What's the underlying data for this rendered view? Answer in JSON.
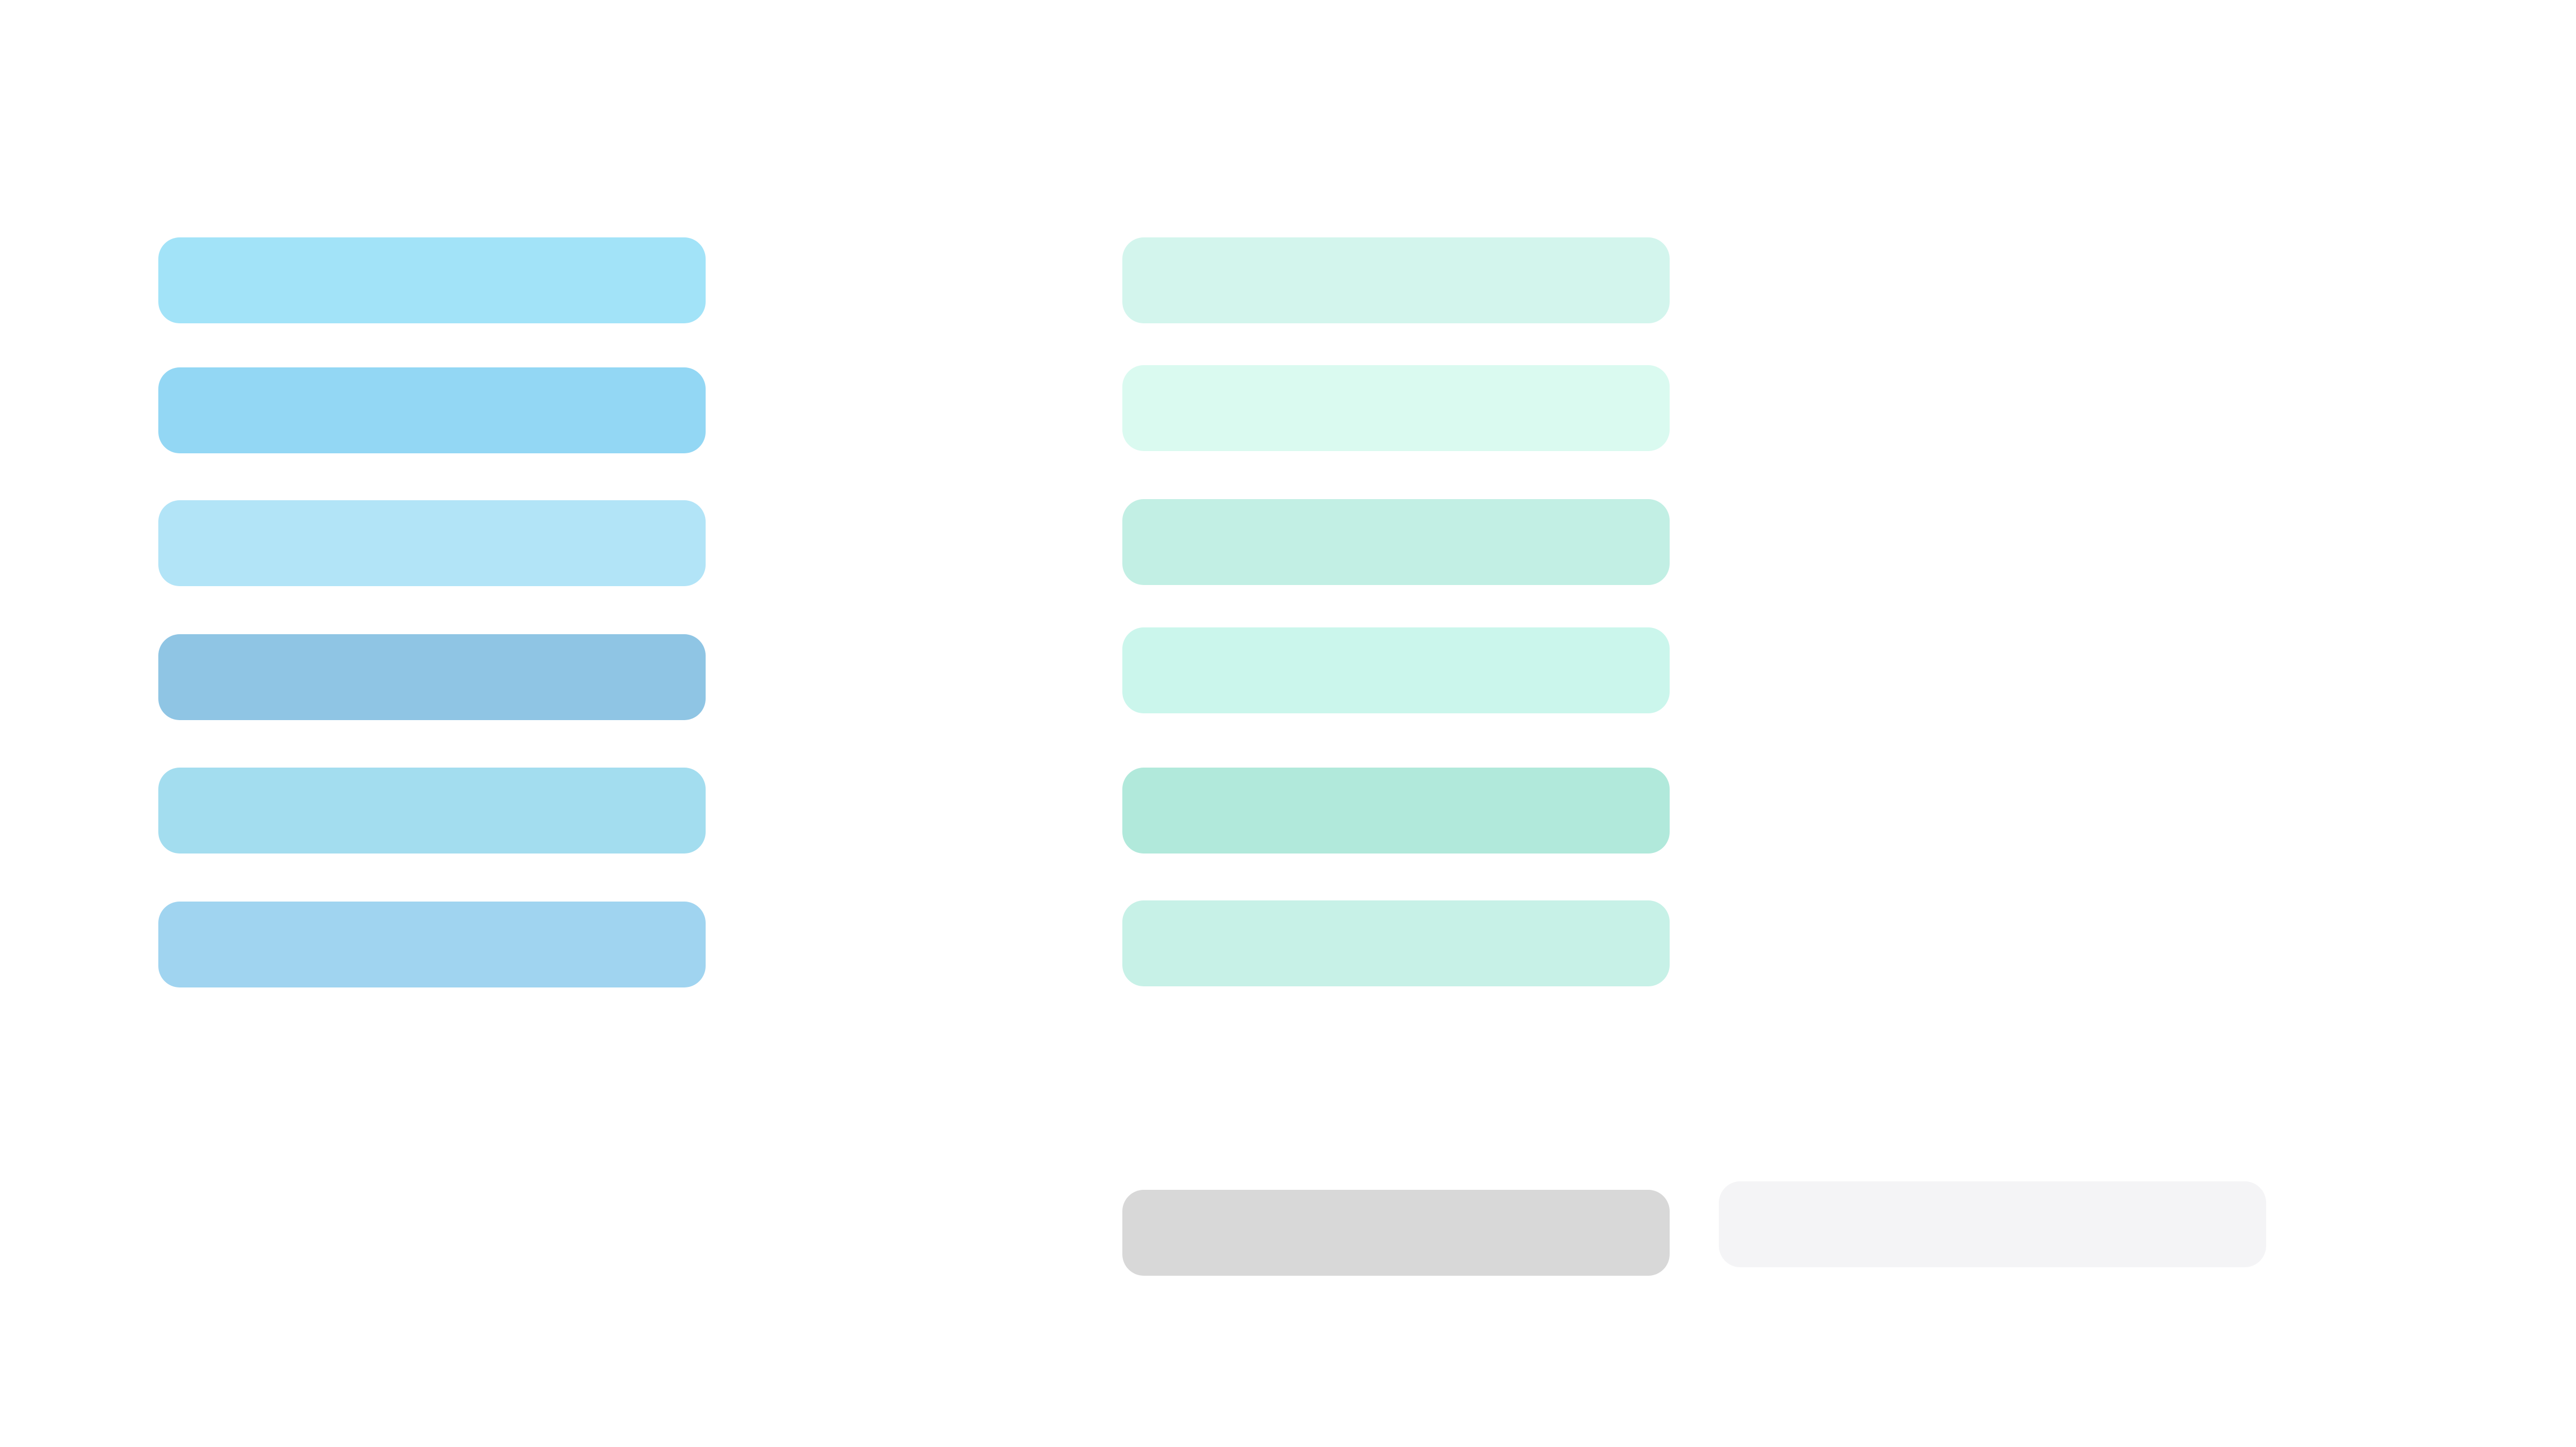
{
  "palettes": {
    "blue": [
      "#a2e3f8",
      "#93d7f4",
      "#b2e4f7",
      "#8fc5e4",
      "#a3ddef",
      "#a0d4f0"
    ],
    "green": [
      "#d3f5ed",
      "#dafaf0",
      "#c2efe4",
      "#cbf6ec",
      "#b1e9db",
      "#c7f1e7"
    ],
    "neutral": [
      "#d8d8d8",
      "#f4f4f6"
    ]
  }
}
